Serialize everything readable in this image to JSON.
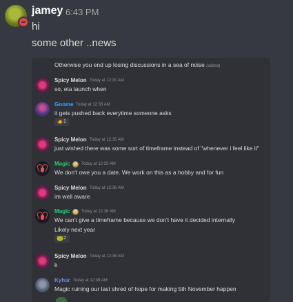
{
  "top_message": {
    "username": "jamey",
    "time": "6:43 PM",
    "lines": [
      "hi",
      "some other ..news"
    ]
  },
  "embed": {
    "header_text": "Otherwise you end up losing discussions in a sea of noise",
    "header_edited": "(edited)",
    "messages": [
      {
        "author": "Spicy Melon",
        "time": "Today at 12:30 AM",
        "text": "so, eta launch when"
      },
      {
        "author": "Gnome",
        "time": "Today at 12:33 AM",
        "text": "it gets pushed back everytime someone asks",
        "reaction": {
          "emoji": "🧔",
          "count": "1"
        }
      },
      {
        "author": "Spicy Melon",
        "time": "Today at 12:35 AM",
        "text": "just wished there was some sort of timeframe instead of \"whenever i feel like it\""
      },
      {
        "author": "Magic",
        "time": "Today at 12:35 AM",
        "text": "We don't owe you a date. We work on this as a hobby and for fun"
      },
      {
        "author": "Spicy Melon",
        "time": "Today at 12:36 AM",
        "text": "im well aware"
      },
      {
        "author": "Magic",
        "time": "Today at 12:36 AM",
        "text": "We can't give a timeframe because we don't have it decided internally",
        "text2": "Likely next year",
        "reaction": {
          "emoji": "🐸",
          "count": "2"
        }
      },
      {
        "author": "Spicy Melon",
        "time": "Today at 12:38 AM",
        "text": "k"
      },
      {
        "author": "Kyhar",
        "time": "Today at 12:39 AM",
        "text": "Magic ruining our last shred of hope for making 5th November happen"
      }
    ]
  },
  "colors": {
    "background": "#36393f",
    "embed_background": "#2f3136",
    "spicy_melon": "#dcddde",
    "gnome": "#3ba3ff",
    "magic": "#2ecc71",
    "kyhar": "#7289da",
    "dnd_status": "#ed4245"
  },
  "icons": {
    "status": "dnd-status-icon",
    "role_badge": "role-badge-icon"
  }
}
